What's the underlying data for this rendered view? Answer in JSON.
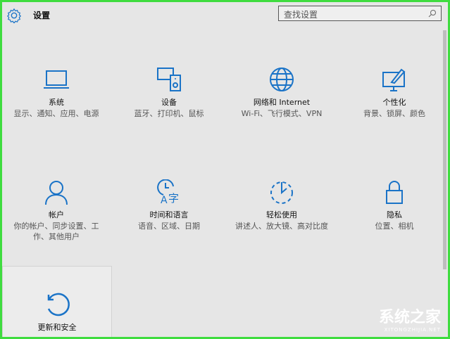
{
  "header": {
    "title": "设置",
    "search_placeholder": "查找设置"
  },
  "accent": "#1a73c7",
  "tiles": [
    {
      "icon": "laptop-icon",
      "title": "系统",
      "desc": "显示、通知、应用、电源"
    },
    {
      "icon": "devices-icon",
      "title": "设备",
      "desc": "蓝牙、打印机、鼠标"
    },
    {
      "icon": "globe-icon",
      "title": "网络和 Internet",
      "desc": "Wi-Fi、飞行模式、VPN"
    },
    {
      "icon": "personalize-icon",
      "title": "个性化",
      "desc": "背景、锁屏、颜色"
    },
    {
      "icon": "person-icon",
      "title": "帐户",
      "desc": "你的帐户、同步设置、工作、其他用户"
    },
    {
      "icon": "time-language-icon",
      "title": "时间和语言",
      "desc": "语音、区域、日期"
    },
    {
      "icon": "ease-of-access-icon",
      "title": "轻松使用",
      "desc": "讲述人、放大镜、高对比度"
    },
    {
      "icon": "lock-icon",
      "title": "隐私",
      "desc": "位置、相机"
    },
    {
      "icon": "update-icon",
      "title": "更新和安全",
      "desc": ""
    }
  ],
  "watermark": {
    "name": "系统之家",
    "url": "XITONGZHIJIA.NET"
  }
}
